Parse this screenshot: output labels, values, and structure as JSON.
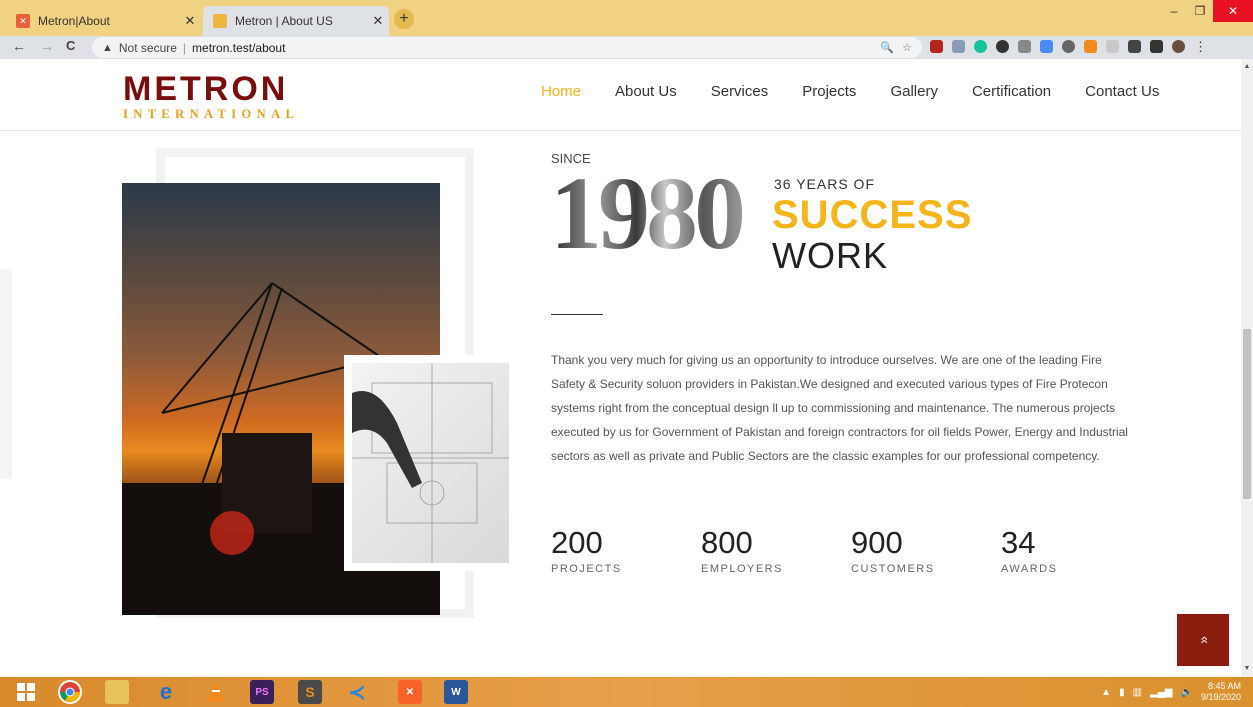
{
  "browser": {
    "tabs": [
      {
        "title": "Metron|About",
        "active": false
      },
      {
        "title": "Metron | About US",
        "active": true
      }
    ],
    "new_tab": "+",
    "security_label": "Not secure",
    "url": "metron.test/about",
    "window_minimize": "–",
    "window_maximize": "❐",
    "window_close": "✕",
    "back": "←",
    "forward": "→",
    "reload": "C",
    "zoom": "🔍",
    "star": "☆",
    "menu_dots": "⋮"
  },
  "site": {
    "logo_top": "METRON",
    "logo_bottom": "INTERNATIONAL",
    "nav": [
      "Home",
      "About Us",
      "Services",
      "Projects",
      "Gallery",
      "Certification",
      "Contact Us"
    ],
    "active_nav": "Home",
    "accent_color": "#f4b41a",
    "brand_color": "#7a0d0d"
  },
  "about": {
    "since": "SINCE",
    "year": "1980",
    "years_of": "36 YEARS OF",
    "success": "SUCCESS",
    "work": "WORK",
    "intro": "Thank you very much for giving us an opportunity to introduce ourselves. We are one of the leading Fire Safety & Security soluon providers in Pakistan.We designed and executed various types of Fire Protecon systems right from the conceptual design ll up to commissioning and maintenance. The numerous projects executed by us for Government of Pakistan and foreign contractors for oil fields Power, Energy and Industrial sectors as well as private and Public Sectors are the classic examples for our professional competency.",
    "stats": [
      {
        "value": "200",
        "label": "PROJECTS"
      },
      {
        "value": "800",
        "label": "EMPLOYERS"
      },
      {
        "value": "900",
        "label": "CUSTOMERS"
      },
      {
        "value": "34",
        "label": "AWARDS"
      }
    ]
  },
  "back_to_top": "»",
  "taskbar": {
    "time": "8:45 AM",
    "date": "9/19/2020"
  }
}
